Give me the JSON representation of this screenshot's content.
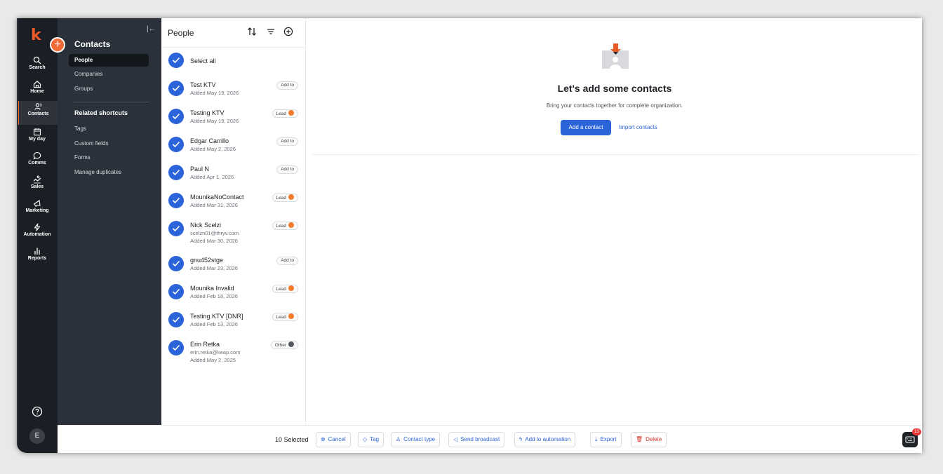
{
  "rail": {
    "items": [
      {
        "label": "Search",
        "icon": "search-icon"
      },
      {
        "label": "Home",
        "icon": "home-icon"
      },
      {
        "label": "Contacts",
        "icon": "contacts-icon"
      },
      {
        "label": "My day",
        "icon": "calendar-icon"
      },
      {
        "label": "Comms",
        "icon": "chat-icon"
      },
      {
        "label": "Sales",
        "icon": "sales-icon"
      },
      {
        "label": "Marketing",
        "icon": "megaphone-icon"
      },
      {
        "label": "Automation",
        "icon": "lightning-icon"
      },
      {
        "label": "Reports",
        "icon": "bar-chart-icon"
      }
    ],
    "avatar": "E",
    "accent": "#f26a36"
  },
  "nav": {
    "title": "Contacts",
    "items": [
      "People",
      "Companies",
      "Groups"
    ],
    "related_title": "Related shortcuts",
    "shortcuts": [
      "Tags",
      "Custom fields",
      "Forms",
      "Manage duplicates"
    ]
  },
  "list": {
    "title": "People",
    "select_all": "Select all",
    "rows": [
      {
        "name": "Test KTV",
        "sub": "",
        "added": "Added May 19, 2026",
        "tag": "Add to",
        "dot": ""
      },
      {
        "name": "Testing KTV",
        "sub": "",
        "added": "Added May 19, 2026",
        "tag": "Lead",
        "dot": "#f47b2a"
      },
      {
        "name": "Edgar Carrillo",
        "sub": "",
        "added": "Added May 2, 2026",
        "tag": "Add to",
        "dot": ""
      },
      {
        "name": "Paul N",
        "sub": "",
        "added": "Added Apr 1, 2026",
        "tag": "Add to",
        "dot": ""
      },
      {
        "name": "MounikaNoContact",
        "sub": "",
        "added": "Added Mar 31, 2026",
        "tag": "Lead",
        "dot": "#f47b2a"
      },
      {
        "name": "Nick Scelzi",
        "sub": "scelzn01@thryv.com",
        "added": "Added Mar 30, 2026",
        "tag": "Lead",
        "dot": "#f47b2a"
      },
      {
        "name": "gnu452stge",
        "sub": "",
        "added": "Added Mar 23, 2026",
        "tag": "Add to",
        "dot": ""
      },
      {
        "name": "Mounika Invalid",
        "sub": "",
        "added": "Added Feb 18, 2026",
        "tag": "Lead",
        "dot": "#f47b2a"
      },
      {
        "name": "Testing KTV [DNR]",
        "sub": "",
        "added": "Added Feb 13, 2026",
        "tag": "Lead",
        "dot": "#f47b2a"
      },
      {
        "name": "Erin Retka",
        "sub": "erin.retka@keap.com",
        "added": "Added May 2, 2025",
        "tag": "Other",
        "dot": "#555a61"
      }
    ]
  },
  "main": {
    "empty_title": "Let's add some contacts",
    "empty_desc": "Bring your contacts together for complete organization.",
    "primary_label": "Add a contact",
    "secondary_label": "Import contacts"
  },
  "bottom": {
    "selected": "10 Selected",
    "actions": [
      {
        "label": "Cancel",
        "icon": "cancel-icon"
      },
      {
        "label": "Tag",
        "icon": "tag-icon"
      },
      {
        "label": "Contact type",
        "icon": "contact-type-icon"
      },
      {
        "label": "Send broadcast",
        "icon": "broadcast-icon"
      },
      {
        "label": "Add to automation",
        "icon": "automation-icon"
      },
      {
        "label": "Export",
        "icon": "export-icon"
      },
      {
        "label": "Delete",
        "icon": "trash-icon"
      }
    ],
    "badge": "13"
  }
}
